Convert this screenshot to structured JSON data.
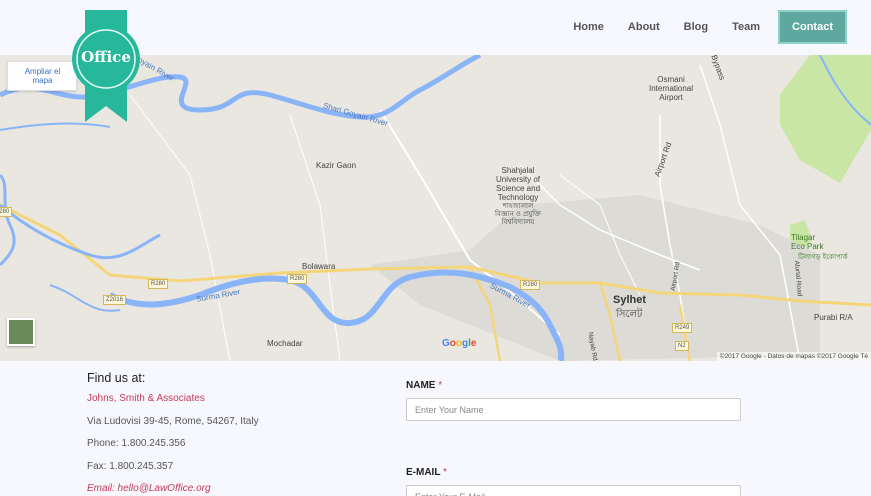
{
  "logo": {
    "text": "Office"
  },
  "nav": {
    "items": [
      {
        "label": "Home"
      },
      {
        "label": "About"
      },
      {
        "label": "Blog"
      },
      {
        "label": "Team"
      },
      {
        "label": "Contact",
        "active": true
      }
    ]
  },
  "map": {
    "enlarge_label": "Ampliar el mapa",
    "google_logo": "Google",
    "attribution": "©2017 Google - Datos de mapas ©2017 Google   Té",
    "labels": {
      "shari_goyain": "Shari Goyain River",
      "goyain": "Goyain River",
      "osmani": "Osmani International Airport",
      "kazir_gaon": "Kazir Gaon",
      "shahjalal": "Shahjalal University of Science and Technology",
      "shahjalal_bn": "শাহজালাল বিজ্ঞান ও প্রযুক্তি বিশ্ববিদ্যালয়",
      "airport_rd": "Airport Rd",
      "tilagar": "Tilagar Eco Park",
      "tilagar_bn": "টিলাগড় ইকোপার্ক",
      "bolawara": "Bolawara",
      "sylhet": "Sylhet",
      "sylhet_bn": "সিলেট",
      "surma": "Surma River",
      "mochadar": "Mochadar",
      "purabi": "Purabi R/A",
      "nayab_rd": "Nayab Rd",
      "alurtal": "Alurtal Road",
      "airport_rd2": "Airport Rd",
      "bypass": "Bypass"
    },
    "road_badges": [
      "R280",
      "R280",
      "R280",
      "Z2016",
      "R249",
      "N2",
      "R280"
    ]
  },
  "findus": {
    "title": "Find us at:",
    "company": "Johns, Smith & Associates",
    "address": "Via Ludovisi 39-45, Rome, 54267, Italy",
    "phone": "Phone: 1.800.245.356",
    "fax": "Fax: 1.800.245.357",
    "email": "Email: hello@LawOffice.org"
  },
  "form": {
    "name_label": "NAME",
    "name_required": "*",
    "name_placeholder": "Enter Your Name",
    "email_label": "E-MAIL",
    "email_required": "*",
    "email_placeholder": "Enter Your E-Mail"
  },
  "colors": {
    "accent": "#5fa8a0",
    "ribbon": "#27b89b",
    "link": "#c23a5a",
    "river": "#8ab4f8",
    "road": "#f5d57a",
    "park": "#c9e6a4"
  }
}
